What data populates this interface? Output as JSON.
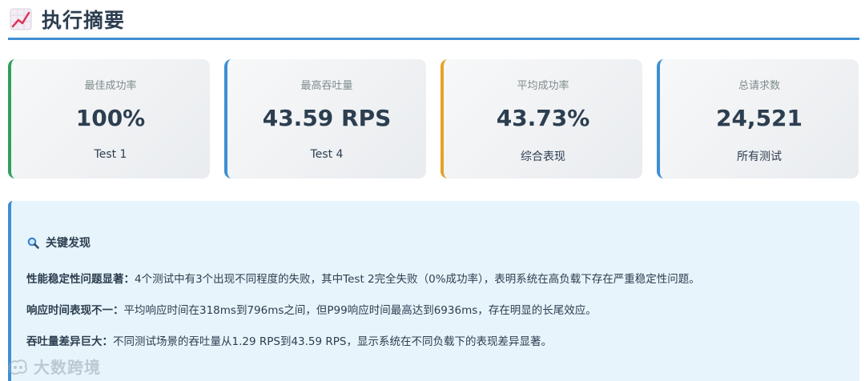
{
  "header": {
    "title": "执行摘要",
    "icon": "chart-increasing-icon"
  },
  "cards": [
    {
      "label": "最佳成功率",
      "value": "100%",
      "sub": "Test 1",
      "accent": "#2ea15a"
    },
    {
      "label": "最高吞吐量",
      "value": "43.59 RPS",
      "sub": "Test 4",
      "accent": "#3d8fd2"
    },
    {
      "label": "平均成功率",
      "value": "43.73%",
      "sub": "综合表现",
      "accent": "#e6a127"
    },
    {
      "label": "总请求数",
      "value": "24,521",
      "sub": "所有测试",
      "accent": "#3d8fd2"
    }
  ],
  "findings": {
    "title": "关键发现",
    "icon": "magnifier-icon",
    "items": [
      {
        "heading": "性能稳定性问题显著：",
        "text": "4个测试中有3个出现不同程度的失败，其中Test 2完全失败（0%成功率），表明系统在高负载下存在严重稳定性问题。"
      },
      {
        "heading": "响应时间表现不一：",
        "text": "平均响应时间在318ms到796ms之间，但P99响应时间最高达到6936ms，存在明显的长尾效应。"
      },
      {
        "heading": "吞吐量差异巨大：",
        "text": "不同测试场景的吞吐量从1.29 RPS到43.59 RPS，显示系统在不同负载下的表现差异显著。"
      }
    ]
  },
  "watermark": {
    "text": "大数跨境"
  }
}
